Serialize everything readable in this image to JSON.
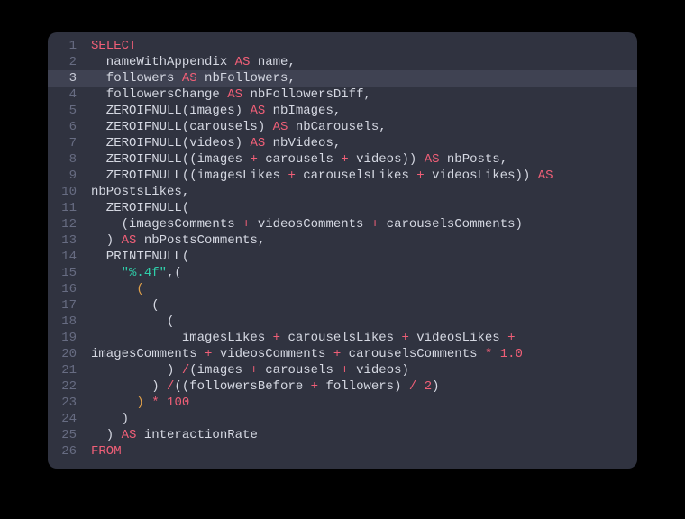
{
  "editor": {
    "highlighted_line": 3,
    "lines": [
      {
        "n": 1,
        "tokens": [
          {
            "c": "kw",
            "t": "SELECT"
          }
        ]
      },
      {
        "n": 2,
        "tokens": [
          {
            "c": "fn",
            "t": "  nameWithAppendix "
          },
          {
            "c": "kw",
            "t": "AS"
          },
          {
            "c": "fn",
            "t": " name,"
          }
        ]
      },
      {
        "n": 3,
        "tokens": [
          {
            "c": "fn",
            "t": "  followers "
          },
          {
            "c": "kw",
            "t": "AS"
          },
          {
            "c": "fn",
            "t": " nbFollowers,"
          }
        ]
      },
      {
        "n": 4,
        "tokens": [
          {
            "c": "fn",
            "t": "  followersChange "
          },
          {
            "c": "kw",
            "t": "AS"
          },
          {
            "c": "fn",
            "t": " nbFollowersDiff,"
          }
        ]
      },
      {
        "n": 5,
        "tokens": [
          {
            "c": "fn",
            "t": "  ZEROIFNULL(images) "
          },
          {
            "c": "kw",
            "t": "AS"
          },
          {
            "c": "fn",
            "t": " nbImages,"
          }
        ]
      },
      {
        "n": 6,
        "tokens": [
          {
            "c": "fn",
            "t": "  ZEROIFNULL(carousels) "
          },
          {
            "c": "kw",
            "t": "AS"
          },
          {
            "c": "fn",
            "t": " nbCarousels,"
          }
        ]
      },
      {
        "n": 7,
        "tokens": [
          {
            "c": "fn",
            "t": "  ZEROIFNULL(videos) "
          },
          {
            "c": "kw",
            "t": "AS"
          },
          {
            "c": "fn",
            "t": " nbVideos,"
          }
        ]
      },
      {
        "n": 8,
        "tokens": [
          {
            "c": "fn",
            "t": "  ZEROIFNULL((images "
          },
          {
            "c": "op",
            "t": "+"
          },
          {
            "c": "fn",
            "t": " carousels "
          },
          {
            "c": "op",
            "t": "+"
          },
          {
            "c": "fn",
            "t": " videos)) "
          },
          {
            "c": "kw",
            "t": "AS"
          },
          {
            "c": "fn",
            "t": " nbPosts,"
          }
        ]
      },
      {
        "n": 9,
        "tokens": [
          {
            "c": "fn",
            "t": "  ZEROIFNULL((imagesLikes "
          },
          {
            "c": "op",
            "t": "+"
          },
          {
            "c": "fn",
            "t": " carouselsLikes "
          },
          {
            "c": "op",
            "t": "+"
          },
          {
            "c": "fn",
            "t": " videosLikes)) "
          },
          {
            "c": "kw",
            "t": "AS"
          }
        ]
      },
      {
        "n": 10,
        "tokens": [
          {
            "c": "fn",
            "t": "nbPostsLikes,"
          }
        ]
      },
      {
        "n": 11,
        "tokens": [
          {
            "c": "fn",
            "t": "  ZEROIFNULL("
          }
        ]
      },
      {
        "n": 12,
        "tokens": [
          {
            "c": "fn",
            "t": "    (imagesComments "
          },
          {
            "c": "op",
            "t": "+"
          },
          {
            "c": "fn",
            "t": " videosComments "
          },
          {
            "c": "op",
            "t": "+"
          },
          {
            "c": "fn",
            "t": " carouselsComments)"
          }
        ]
      },
      {
        "n": 13,
        "tokens": [
          {
            "c": "fn",
            "t": "  ) "
          },
          {
            "c": "kw",
            "t": "AS"
          },
          {
            "c": "fn",
            "t": " nbPostsComments,"
          }
        ]
      },
      {
        "n": 14,
        "tokens": [
          {
            "c": "fn",
            "t": "  PRINTFNULL("
          }
        ]
      },
      {
        "n": 15,
        "tokens": [
          {
            "c": "fn",
            "t": "    "
          },
          {
            "c": "str",
            "t": "\"%.4f\""
          },
          {
            "c": "fn",
            "t": ",("
          }
        ]
      },
      {
        "n": 16,
        "tokens": [
          {
            "c": "fn",
            "t": "      "
          },
          {
            "c": "paren",
            "t": "("
          }
        ]
      },
      {
        "n": 17,
        "tokens": [
          {
            "c": "fn",
            "t": "        ("
          }
        ]
      },
      {
        "n": 18,
        "tokens": [
          {
            "c": "fn",
            "t": "          ("
          }
        ]
      },
      {
        "n": 19,
        "tokens": [
          {
            "c": "fn",
            "t": "            imagesLikes "
          },
          {
            "c": "op",
            "t": "+"
          },
          {
            "c": "fn",
            "t": " carouselsLikes "
          },
          {
            "c": "op",
            "t": "+"
          },
          {
            "c": "fn",
            "t": " videosLikes "
          },
          {
            "c": "op",
            "t": "+"
          }
        ]
      },
      {
        "n": 20,
        "tokens": [
          {
            "c": "fn",
            "t": "imagesComments "
          },
          {
            "c": "op",
            "t": "+"
          },
          {
            "c": "fn",
            "t": " videosComments "
          },
          {
            "c": "op",
            "t": "+"
          },
          {
            "c": "fn",
            "t": " carouselsComments "
          },
          {
            "c": "op",
            "t": "*"
          },
          {
            "c": "fn",
            "t": " "
          },
          {
            "c": "num",
            "t": "1.0"
          }
        ]
      },
      {
        "n": 21,
        "tokens": [
          {
            "c": "fn",
            "t": "          ) "
          },
          {
            "c": "op",
            "t": "/"
          },
          {
            "c": "fn",
            "t": "(images "
          },
          {
            "c": "op",
            "t": "+"
          },
          {
            "c": "fn",
            "t": " carousels "
          },
          {
            "c": "op",
            "t": "+"
          },
          {
            "c": "fn",
            "t": " videos)"
          }
        ]
      },
      {
        "n": 22,
        "tokens": [
          {
            "c": "fn",
            "t": "        ) "
          },
          {
            "c": "op",
            "t": "/"
          },
          {
            "c": "fn",
            "t": "((followersBefore "
          },
          {
            "c": "op",
            "t": "+"
          },
          {
            "c": "fn",
            "t": " followers) "
          },
          {
            "c": "op",
            "t": "/"
          },
          {
            "c": "fn",
            "t": " "
          },
          {
            "c": "num",
            "t": "2"
          },
          {
            "c": "fn",
            "t": ")"
          }
        ]
      },
      {
        "n": 23,
        "tokens": [
          {
            "c": "fn",
            "t": "      "
          },
          {
            "c": "paren",
            "t": ")"
          },
          {
            "c": "fn",
            "t": " "
          },
          {
            "c": "op",
            "t": "*"
          },
          {
            "c": "fn",
            "t": " "
          },
          {
            "c": "num",
            "t": "100"
          }
        ]
      },
      {
        "n": 24,
        "tokens": [
          {
            "c": "fn",
            "t": "    )"
          }
        ]
      },
      {
        "n": 25,
        "tokens": [
          {
            "c": "fn",
            "t": "  ) "
          },
          {
            "c": "kw",
            "t": "AS"
          },
          {
            "c": "fn",
            "t": " interactionRate"
          }
        ]
      },
      {
        "n": 26,
        "tokens": [
          {
            "c": "kw",
            "t": "FROM"
          }
        ]
      }
    ]
  }
}
